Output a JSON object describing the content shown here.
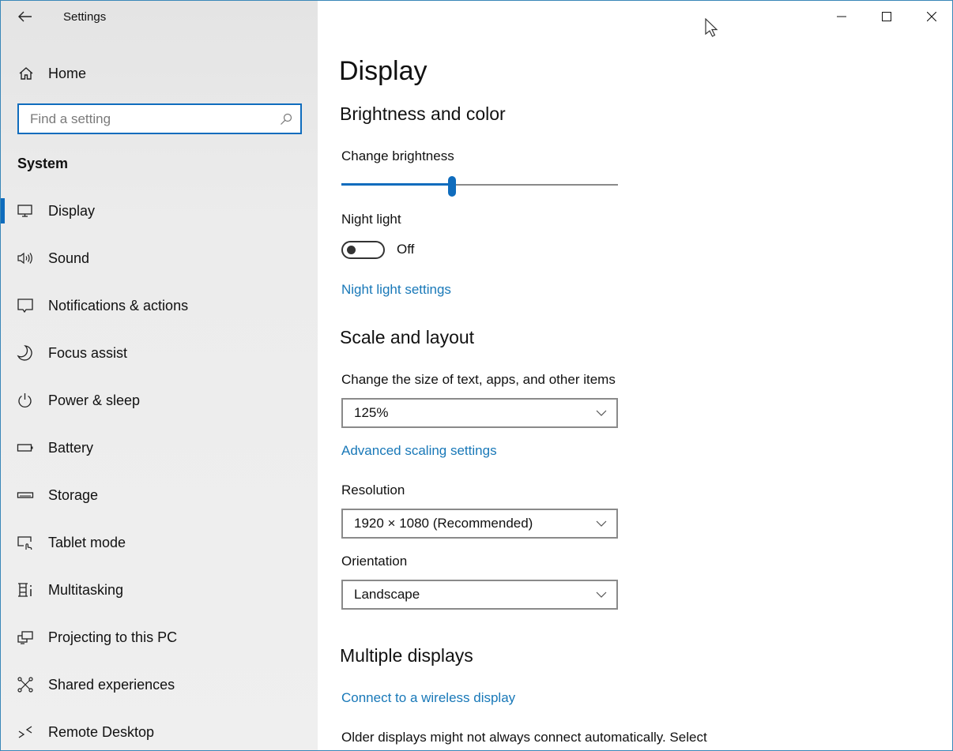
{
  "window": {
    "title": "Settings",
    "caption": {
      "minimize": "minimize",
      "maximize": "maximize",
      "close": "close"
    },
    "border_color": "#3a87b8"
  },
  "sidebar": {
    "home_label": "Home",
    "search": {
      "placeholder": "Find a setting",
      "value": ""
    },
    "section_label": "System",
    "items": [
      {
        "label": "Display",
        "icon": "monitor-icon",
        "active": true
      },
      {
        "label": "Sound",
        "icon": "speaker-icon",
        "active": false
      },
      {
        "label": "Notifications & actions",
        "icon": "notification-icon",
        "active": false
      },
      {
        "label": "Focus assist",
        "icon": "moon-icon",
        "active": false
      },
      {
        "label": "Power & sleep",
        "icon": "power-icon",
        "active": false
      },
      {
        "label": "Battery",
        "icon": "battery-icon",
        "active": false
      },
      {
        "label": "Storage",
        "icon": "storage-icon",
        "active": false
      },
      {
        "label": "Tablet mode",
        "icon": "tablet-mode-icon",
        "active": false
      },
      {
        "label": "Multitasking",
        "icon": "multitasking-icon",
        "active": false
      },
      {
        "label": "Projecting to this PC",
        "icon": "projecting-icon",
        "active": false
      },
      {
        "label": "Shared experiences",
        "icon": "shared-experiences-icon",
        "active": false
      },
      {
        "label": "Remote Desktop",
        "icon": "remote-desktop-icon",
        "active": false
      }
    ]
  },
  "main": {
    "title": "Display",
    "brightness_section": {
      "heading": "Brightness and color",
      "brightness_label": "Change brightness",
      "brightness_value": 40,
      "night_light_label": "Night light",
      "night_light_on": false,
      "night_light_state": "Off",
      "night_light_settings_link": "Night light settings"
    },
    "scale_section": {
      "heading": "Scale and layout",
      "scale_label": "Change the size of text, apps, and other items",
      "scale_value": "125%",
      "advanced_scaling_link": "Advanced scaling settings",
      "resolution_label": "Resolution",
      "resolution_value": "1920 × 1080 (Recommended)",
      "orientation_label": "Orientation",
      "orientation_value": "Landscape"
    },
    "multiple_displays_section": {
      "heading": "Multiple displays",
      "wireless_link": "Connect to a wireless display",
      "description": "Older displays might not always connect automatically. Select"
    }
  },
  "colors": {
    "accent": "#0f6cbd",
    "link": "#1878b8",
    "sidebar_bg": "#ececec"
  }
}
